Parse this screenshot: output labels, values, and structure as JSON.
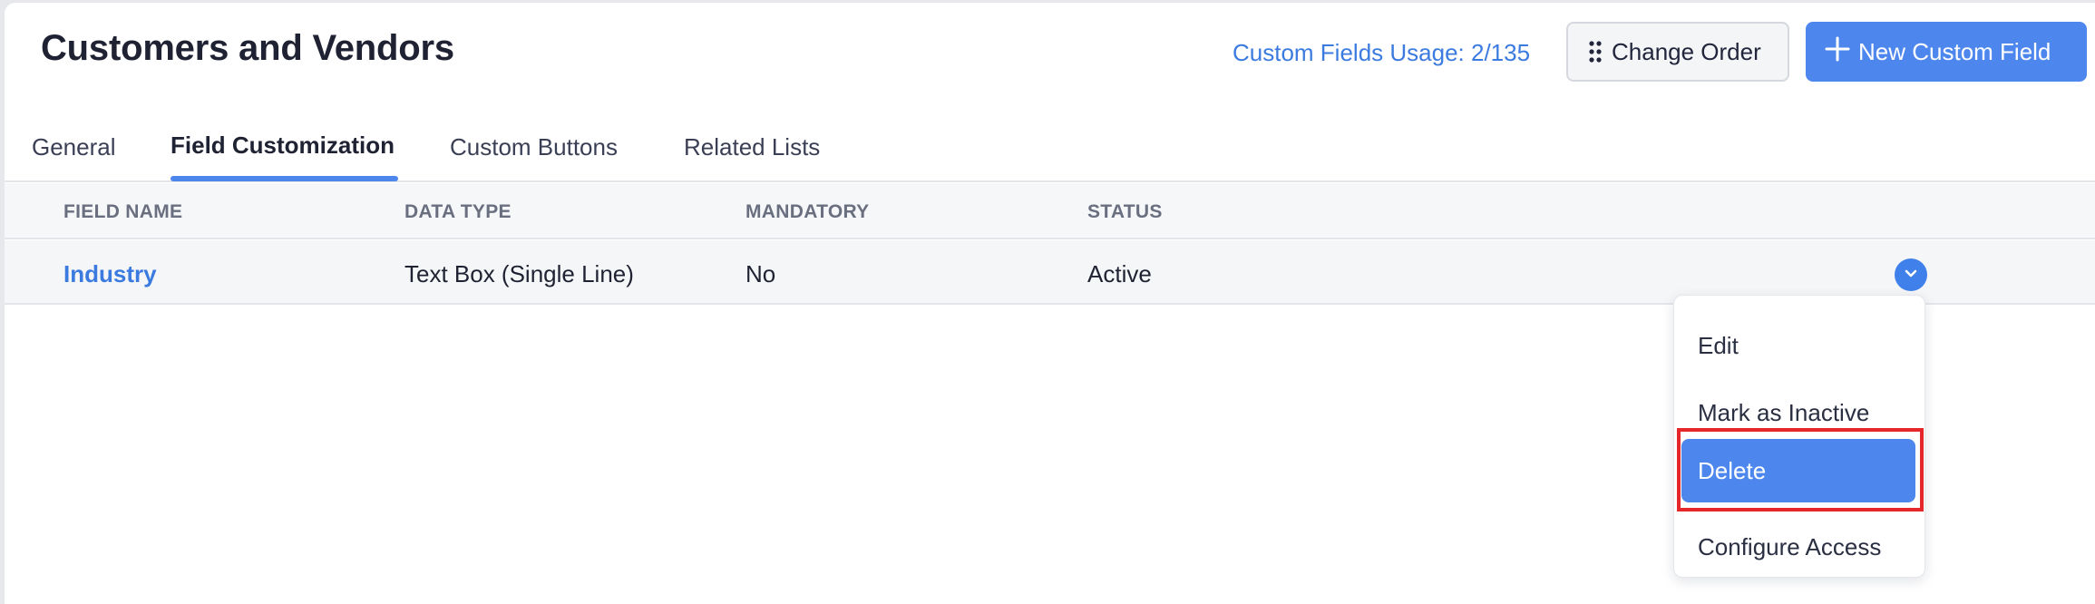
{
  "page": {
    "title": "Customers and Vendors"
  },
  "header": {
    "usage_label": "Custom Fields Usage: 2/135",
    "change_order_label": "Change Order",
    "new_field_label": "New Custom Field"
  },
  "tabs": [
    {
      "label": "General",
      "active": false
    },
    {
      "label": "Field Customization",
      "active": true
    },
    {
      "label": "Custom Buttons",
      "active": false
    },
    {
      "label": "Related Lists",
      "active": false
    }
  ],
  "table": {
    "columns": [
      "FIELD NAME",
      "DATA TYPE",
      "MANDATORY",
      "STATUS"
    ],
    "rows": [
      {
        "field_name": "Industry",
        "data_type": "Text Box (Single Line)",
        "mandatory": "No",
        "status": "Active"
      }
    ]
  },
  "row_menu": {
    "items": [
      {
        "label": "Edit",
        "selected": false
      },
      {
        "label": "Mark as Inactive",
        "selected": false
      },
      {
        "label": "Delete",
        "selected": true
      },
      {
        "label": "Configure Access",
        "selected": false
      }
    ]
  },
  "icons": {
    "change_order": "drag-grid-icon",
    "new_field": "plus-icon",
    "row_toggle": "chevron-down-icon"
  },
  "colors": {
    "accent": "#4d87ee",
    "link": "#3b7be0",
    "highlight_box": "#e5262b"
  }
}
